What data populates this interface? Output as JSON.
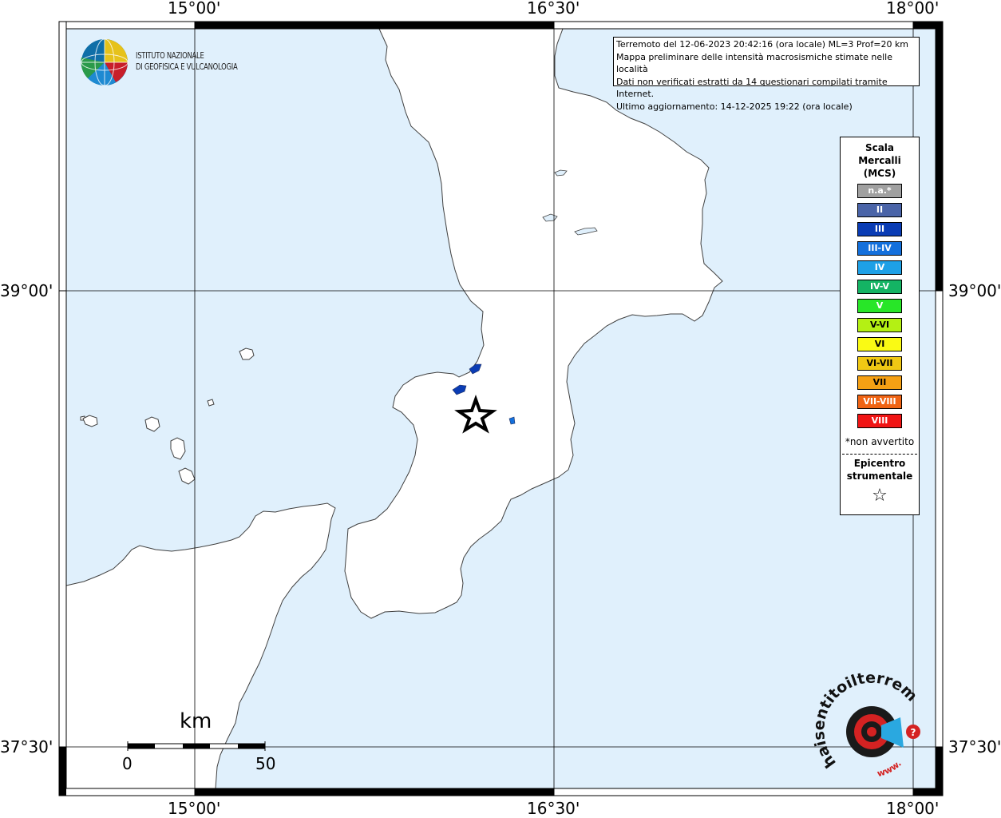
{
  "map": {
    "title_lines": [
      "Terremoto del 12-06-2023 20:42:16 (ora locale) ML=3 Prof=20 km",
      "Mappa preliminare delle intensità macrosismiche stimate nelle località",
      "Dati non verificati estratti da 14 questionari compilati tramite Internet.",
      "Ultimo aggiornamento: 14-12-2025 19:22 (ora locale)"
    ],
    "longitude_labels": [
      "15°00'",
      "16°30'",
      "18°00'"
    ],
    "latitude_labels": [
      "39°00'",
      "37°30'"
    ],
    "colors": {
      "sea": "#e0f0fc",
      "land": "#ffffff",
      "coast": "#404040",
      "grid": "#000000"
    }
  },
  "institute": {
    "name_line1": "ISTITUTO NAZIONALE",
    "name_line2": "DI GEOFISICA E VULCANOLOGIA",
    "logo_icon": "ingv-globe-logo"
  },
  "legend": {
    "title_lines": [
      "Scala",
      "Mercalli",
      "(MCS)"
    ],
    "classes": [
      {
        "label": "n.a.*",
        "color": "#a0a0a0"
      },
      {
        "label": "II",
        "color": "#4a64a8"
      },
      {
        "label": "III",
        "color": "#0a3cb4"
      },
      {
        "label": "III-IV",
        "color": "#1470dc"
      },
      {
        "label": "IV",
        "color": "#1ea0e6"
      },
      {
        "label": "IV-V",
        "color": "#14b464"
      },
      {
        "label": "V",
        "color": "#28e628"
      },
      {
        "label": "V-VI",
        "color": "#b4f014"
      },
      {
        "label": "VI",
        "color": "#fafa14"
      },
      {
        "label": "VI-VII",
        "color": "#f0c814"
      },
      {
        "label": "VII",
        "color": "#f5a014"
      },
      {
        "label": "VII-VIII",
        "color": "#f06414"
      },
      {
        "label": "VIII",
        "color": "#f01414"
      }
    ],
    "note": "*non avvertito",
    "epicenter_lines": [
      "Epicentro",
      "strumentale"
    ],
    "epicenter_icon": "star-icon"
  },
  "scalebar": {
    "unit": "km",
    "start_label": "0",
    "end_label": "50"
  },
  "brand": {
    "text_main": "haisentitoilterremoto.it",
    "text_prefix": "www.",
    "logo_icon": "seismic-target-logo"
  }
}
